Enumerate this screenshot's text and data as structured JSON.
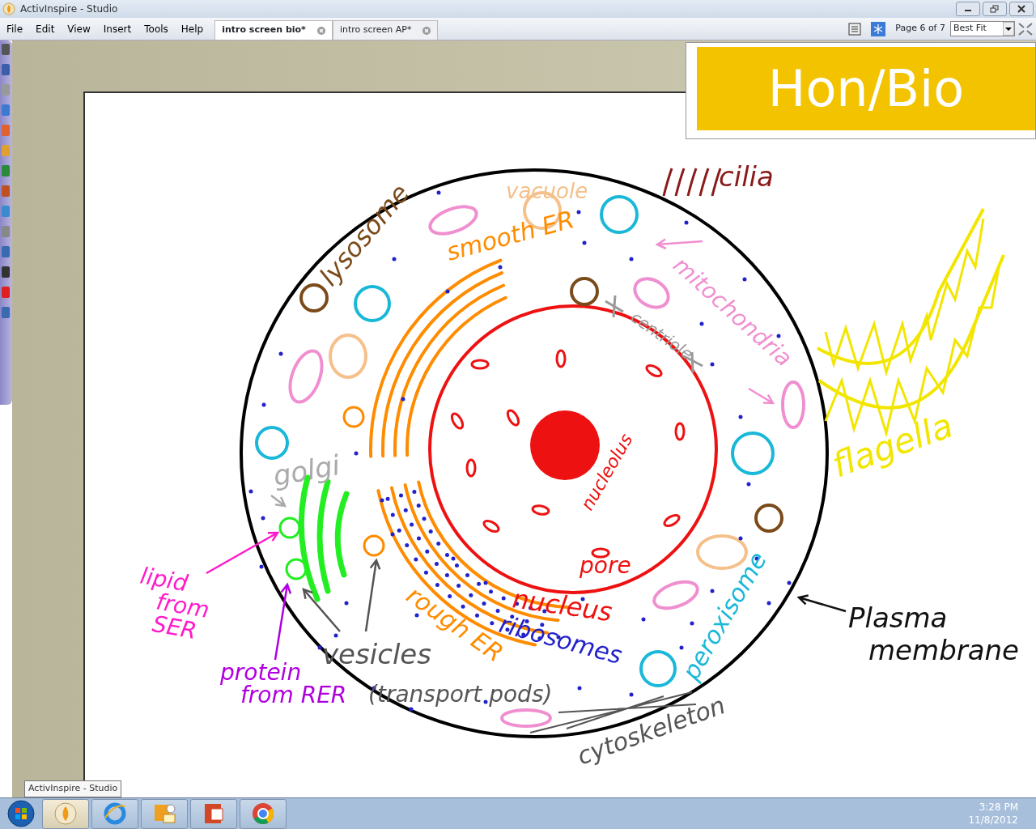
{
  "window": {
    "title": "ActivInspire - Studio"
  },
  "menu": [
    "File",
    "Edit",
    "View",
    "Insert",
    "Tools",
    "Help"
  ],
  "tabs": [
    {
      "label": "intro screen bio*",
      "selected": true
    },
    {
      "label": "intro screen AP*",
      "selected": false
    }
  ],
  "page_indicator": "Page 6 of 7",
  "zoom": {
    "value": "Best Fit"
  },
  "page_title": "Hon/Bio",
  "labels": [
    {
      "lines": [
        "vacuole"
      ],
      "color": "#f5c08a"
    },
    {
      "lines": [
        "cilia"
      ],
      "color": "#8b1a1a"
    },
    {
      "lines": [
        "lysosome"
      ],
      "color": "#7a4a1a"
    },
    {
      "lines": [
        "smooth ER"
      ],
      "color": "#ff8c00"
    },
    {
      "lines": [
        "mitochondria"
      ],
      "color": "#f08fd0"
    },
    {
      "lines": [
        "centriole"
      ],
      "color": "#999999"
    },
    {
      "lines": [
        "flagella"
      ],
      "color": "#f2e600"
    },
    {
      "lines": [
        "golgi"
      ],
      "color": "#aaaaaa"
    },
    {
      "lines": [
        "nucleolus"
      ],
      "color": "#ee1111"
    },
    {
      "lines": [
        "lipid",
        "from",
        "SER"
      ],
      "color": "#ff1acb"
    },
    {
      "lines": [
        "pore"
      ],
      "color": "#ee1111"
    },
    {
      "lines": [
        "nucleus"
      ],
      "color": "#ee1111"
    },
    {
      "lines": [
        "rough ER"
      ],
      "color": "#ff8c00"
    },
    {
      "lines": [
        "ribosomes"
      ],
      "color": "#2222cc"
    },
    {
      "lines": [
        "vesicles"
      ],
      "color": "#555555"
    },
    {
      "lines": [
        "protein",
        "from RER"
      ],
      "color": "#b000e0"
    },
    {
      "lines": [
        "(transport pods)"
      ],
      "color": "#555555"
    },
    {
      "lines": [
        "peroxisome"
      ],
      "color": "#19b8d8"
    },
    {
      "lines": [
        "Plasma",
        "membrane"
      ],
      "color": "#111111"
    },
    {
      "lines": [
        "cytoskeleton"
      ],
      "color": "#555555"
    }
  ],
  "tooltip": "ActivInspire - Studio",
  "taskbar": {
    "apps": [
      {
        "kind": "start",
        "selected": false
      },
      {
        "kind": "activinspire",
        "selected": true
      },
      {
        "kind": "browser",
        "selected": false
      },
      {
        "kind": "mail",
        "selected": false
      },
      {
        "kind": "slides",
        "selected": false
      },
      {
        "kind": "chrome",
        "selected": false
      }
    ],
    "time": "3:28 PM",
    "date": "11/8/2012"
  }
}
